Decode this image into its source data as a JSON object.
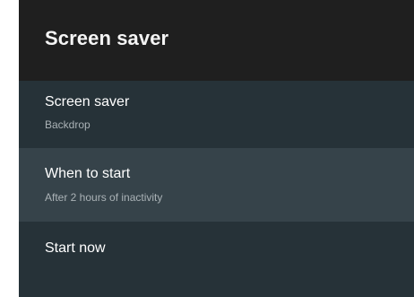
{
  "header": {
    "title": "Screen saver"
  },
  "menu": {
    "items": [
      {
        "title": "Screen saver",
        "subtitle": "Backdrop"
      },
      {
        "title": "When to start",
        "subtitle": "After 2 hours of inactivity"
      },
      {
        "title": "Start now",
        "subtitle": ""
      }
    ],
    "focused_index": 1
  },
  "colors": {
    "panel_background": "#263238",
    "header_background": "#1f1f1f",
    "focused_item_background": "#36434a",
    "primary_text": "#ffffff",
    "secondary_text": "#aab2b6"
  }
}
